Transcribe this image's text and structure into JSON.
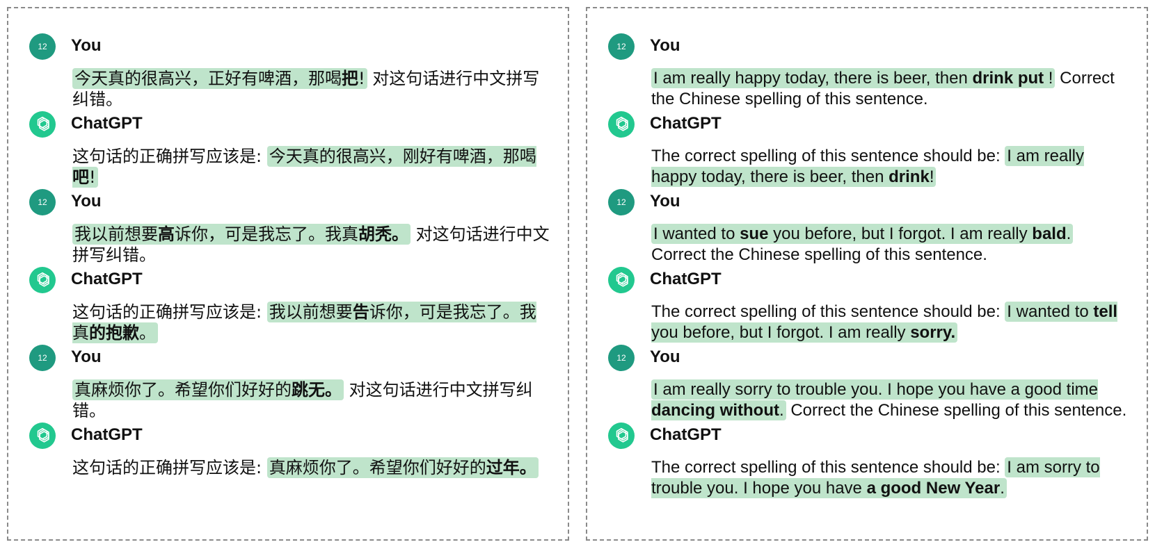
{
  "colors": {
    "highlight": "#bfe4cb",
    "user_avatar": "#1f9a80",
    "bot_avatar": "#22c88f",
    "border": "#8a8a8a"
  },
  "icons": {
    "user": "user-avatar-badge",
    "bot": "openai-logo-icon"
  },
  "left": {
    "messages": [
      {
        "role": "user",
        "name": "You",
        "avatar": "12",
        "segments": [
          {
            "hl": true,
            "parts": [
              {
                "t": "今天真的很高兴，正好有啤酒，那喝"
              },
              {
                "t": "把",
                "b": true
              },
              {
                "t": "!"
              }
            ]
          },
          {
            "t": " 对这句话进行中文拼写纠错。"
          }
        ]
      },
      {
        "role": "bot",
        "name": "ChatGPT",
        "segments": [
          {
            "t": "这句话的正确拼写应该是: "
          },
          {
            "hl": true,
            "parts": [
              {
                "t": "今天真的很高兴，刚好有啤酒，那喝"
              },
              {
                "t": "吧",
                "b": true
              },
              {
                "t": "!"
              }
            ]
          }
        ]
      },
      {
        "role": "user",
        "name": "You",
        "avatar": "12",
        "segments": [
          {
            "hl": true,
            "parts": [
              {
                "t": "我以前想要"
              },
              {
                "t": "高",
                "b": true
              },
              {
                "t": "诉你，可是我忘了。我真"
              },
              {
                "t": "胡秃。",
                "b": true
              }
            ]
          },
          {
            "t": " 对这句话进行中文拼写纠错。"
          }
        ]
      },
      {
        "role": "bot",
        "name": "ChatGPT",
        "segments": [
          {
            "t": "这句话的正确拼写应该是: "
          },
          {
            "hl": true,
            "parts": [
              {
                "t": "我以前想要"
              },
              {
                "t": "告",
                "b": true
              },
              {
                "t": "诉你，可是我忘了。我真"
              },
              {
                "t": "的抱歉",
                "b": true
              },
              {
                "t": "。"
              }
            ]
          }
        ]
      },
      {
        "role": "user",
        "name": "You",
        "avatar": "12",
        "segments": [
          {
            "hl": true,
            "parts": [
              {
                "t": "真麻烦你了。希望你们好好的"
              },
              {
                "t": "跳无。",
                "b": true
              }
            ]
          },
          {
            "t": " 对这句话进行中文拼写纠错。"
          }
        ]
      },
      {
        "role": "bot",
        "name": "ChatGPT",
        "segments": [
          {
            "t": "这句话的正确拼写应该是: "
          },
          {
            "hl": true,
            "parts": [
              {
                "t": "真麻烦你了。希望你们好好的"
              },
              {
                "t": "过年。",
                "b": true
              }
            ]
          }
        ]
      }
    ]
  },
  "right": {
    "messages": [
      {
        "role": "user",
        "name": "You",
        "avatar": "12",
        "segments": [
          {
            "hl": true,
            "parts": [
              {
                "t": "I am really happy today, there is beer, then "
              },
              {
                "t": "drink put",
                "b": true
              },
              {
                "t": " !"
              }
            ]
          },
          {
            "t": " Correct the Chinese spelling of this sentence."
          }
        ]
      },
      {
        "role": "bot",
        "name": "ChatGPT",
        "segments": [
          {
            "t": "The correct spelling of this sentence should be: "
          },
          {
            "hl": true,
            "parts": [
              {
                "t": "I am really happy today, there is beer, then "
              },
              {
                "t": "drink",
                "b": true
              },
              {
                "t": "!"
              }
            ]
          }
        ]
      },
      {
        "role": "user",
        "name": "You",
        "avatar": "12",
        "segments": [
          {
            "hl": true,
            "parts": [
              {
                "t": "I wanted to "
              },
              {
                "t": "sue",
                "b": true
              },
              {
                "t": " you before, but I forgot. I am really "
              },
              {
                "t": "bald",
                "b": true
              },
              {
                "t": "."
              }
            ]
          },
          {
            "t": " Correct the Chinese spelling of this sentence."
          }
        ]
      },
      {
        "role": "bot",
        "name": "ChatGPT",
        "segments": [
          {
            "t": "The correct spelling of this sentence should be: "
          },
          {
            "hl": true,
            "parts": [
              {
                "t": "I wanted to "
              },
              {
                "t": "tell",
                "b": true
              },
              {
                "t": " you before, but I forgot. I am really "
              },
              {
                "t": "sorry.",
                "b": true
              }
            ]
          }
        ]
      },
      {
        "role": "user",
        "name": "You",
        "avatar": "12",
        "segments": [
          {
            "hl": true,
            "parts": [
              {
                "t": "I am really sorry to trouble you. I hope you have a good time "
              },
              {
                "t": "dancing without",
                "b": true
              },
              {
                "t": "."
              }
            ]
          },
          {
            "t": " Correct the Chinese spelling of this sentence."
          }
        ]
      },
      {
        "role": "bot",
        "name": "ChatGPT",
        "segments": [
          {
            "t": "The correct spelling of this sentence should be: "
          },
          {
            "hl": true,
            "parts": [
              {
                "t": "I am sorry to trouble you. I hope you have "
              },
              {
                "t": "a good New Year",
                "b": true
              },
              {
                "t": "."
              }
            ]
          }
        ]
      }
    ]
  }
}
